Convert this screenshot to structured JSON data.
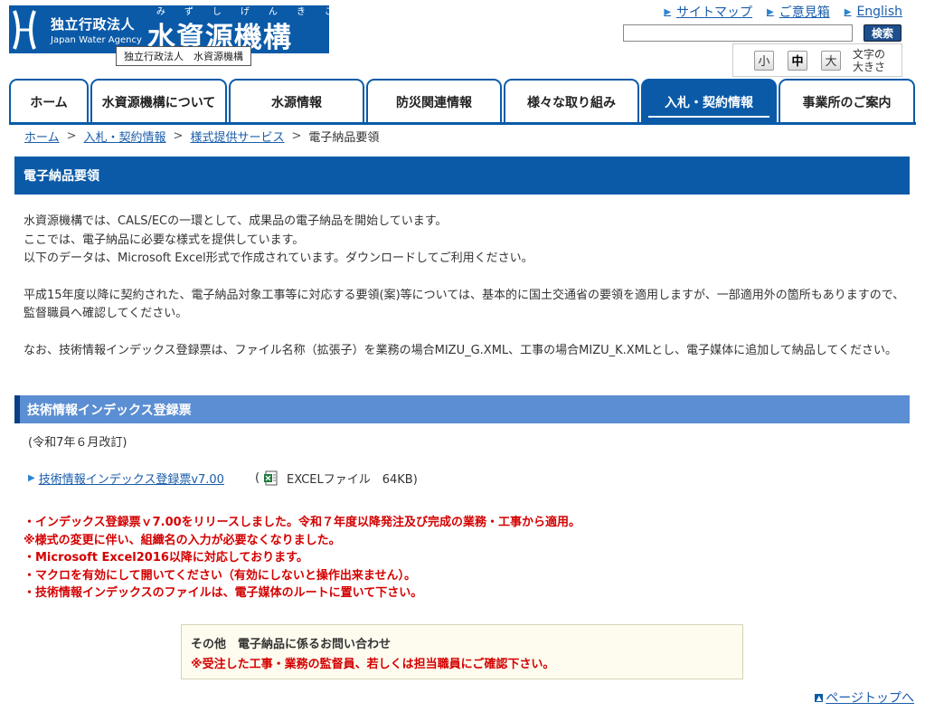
{
  "header": {
    "logo_org_type": "独立行政法人",
    "logo_english": "Japan Water Agency",
    "logo_name": "水資源機構",
    "logo_ruby": "みずしげんきこう",
    "logo_tooltip": "独立行政法人　水資源機構",
    "links": [
      {
        "label": "サイトマップ"
      },
      {
        "label": "ご意見箱"
      },
      {
        "label": "English"
      }
    ],
    "search_button": "検索",
    "search_value": "",
    "font_sizes": [
      "小",
      "中",
      "大"
    ],
    "font_size_selected": "中",
    "font_size_label_1": "文字の",
    "font_size_label_2": "大きさ"
  },
  "nav": {
    "tabs": [
      {
        "label": "ホーム"
      },
      {
        "label": "水資源機構について"
      },
      {
        "label": "水源情報"
      },
      {
        "label": "防災関連情報"
      },
      {
        "label": "様々な取り組み"
      },
      {
        "label": "入札・契約情報"
      },
      {
        "label": "事業所のご案内"
      }
    ],
    "active": "入札・契約情報"
  },
  "breadcrumb": {
    "items": [
      "ホーム",
      "入札・契約情報",
      "様式提供サービス"
    ],
    "current": "電子納品要領",
    "separator": ">"
  },
  "page": {
    "title": "電子納品要領",
    "para1_line1": "水資源機構では、CALS/ECの一環として、成果品の電子納品を開始しています。",
    "para1_line2": "ここでは、電子納品に必要な様式を提供しています。",
    "para1_line3": "以下のデータは、Microsoft Excel形式で作成されています。ダウンロードしてご利用ください。",
    "para2": "平成15年度以降に契約された、電子納品対象工事等に対応する要領(案)等については、基本的に国土交通省の要領を適用しますが、一部適用外の箇所もありますので、監督職員へ確認してください。",
    "para3": "なお、技術情報インデックス登録票は、ファイル名称（拡張子）を業務の場合MIZU_G.XML、工事の場合MIZU_K.XMLとし、電子媒体に追加して納品してください。"
  },
  "section": {
    "title": "技術情報インデックス登録票",
    "revised": "(令和7年６月改訂)",
    "download_link": "技術情報インデックス登録票v7.00",
    "file_open": "(",
    "file_info": "EXCELファイル　64KB)",
    "notes": [
      "・インデックス登録票ｖ7.00をリリースしました。令和７年度以降発注及び完成の業務・工事から適用。",
      "※様式の変更に伴い、組織名の入力が必要なくなりました。",
      "・Microsoft Excel2016以降に対応しております。",
      "・マクロを有効にして開いてください（有効にしないと操作出来ません）。",
      "・技術情報インデックスのファイルは、電子媒体のルートに置いて下さい。"
    ]
  },
  "contact": {
    "title": "その他　電子納品に係るお問い合わせ",
    "note": "※受注した工事・業務の監督員、若しくは担当職員にご確認下さい。"
  },
  "footer": {
    "page_top": "ページトップへ"
  }
}
